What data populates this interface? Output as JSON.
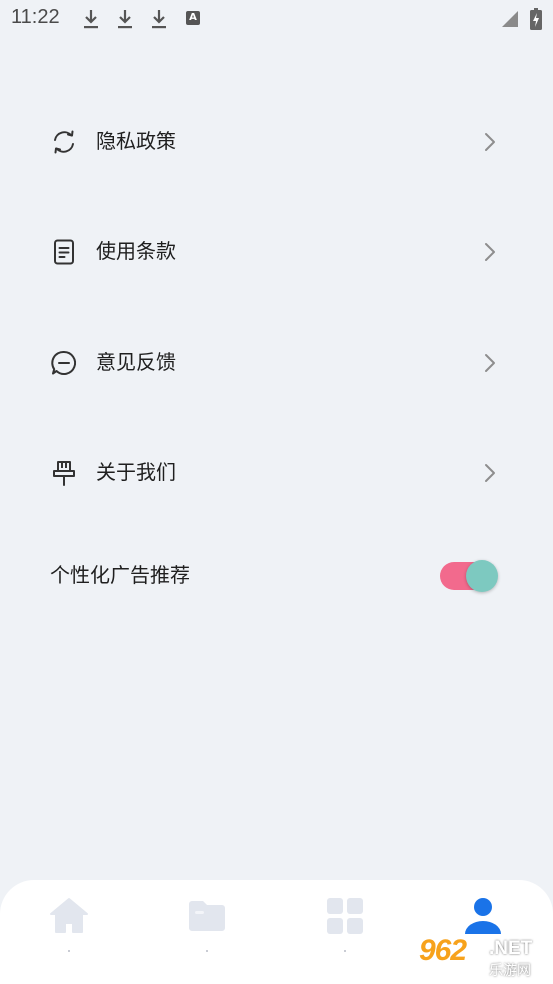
{
  "status_bar": {
    "time": "11:22",
    "input_badge": "A"
  },
  "menu": [
    {
      "label": "隐私政策",
      "icon": "refresh-icon"
    },
    {
      "label": "使用条款",
      "icon": "document-icon"
    },
    {
      "label": "意见反馈",
      "icon": "chat-icon"
    },
    {
      "label": "关于我们",
      "icon": "pin-icon"
    }
  ],
  "ads_setting": {
    "label": "个性化广告推荐",
    "enabled": true
  },
  "tabbar": {
    "tabs": [
      {
        "icon": "home-icon",
        "active": false
      },
      {
        "icon": "folder-icon",
        "active": false
      },
      {
        "icon": "grid-icon",
        "active": false
      },
      {
        "icon": "user-icon",
        "active": true
      }
    ]
  },
  "watermark": {
    "number": "962",
    "domain": ".NET",
    "brand": "乐游网"
  },
  "colors": {
    "background": "#eff2f6",
    "toggle_track": "#f26a8d",
    "toggle_thumb": "#7dc9c0",
    "active_tab": "#1a73e8",
    "inactive_tab": "#e2e6ee"
  }
}
